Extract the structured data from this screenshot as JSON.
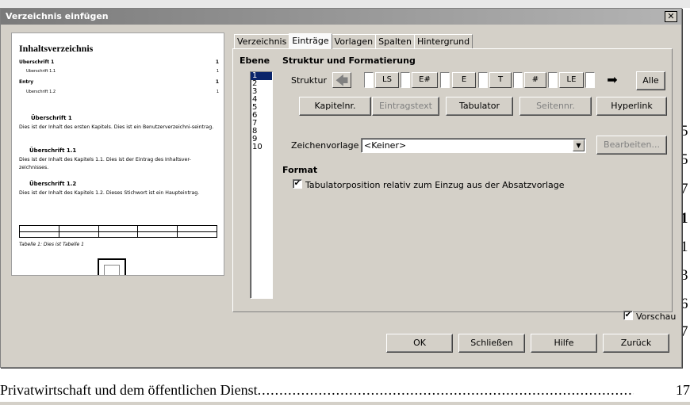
{
  "background": {
    "right_digits": [
      "5",
      "5",
      "7",
      "1",
      "1",
      "3",
      "6",
      "7"
    ],
    "bottom_line": {
      "text": "Privatwirtschaft und dem öffentlichen Dienst",
      "dots": "......................................................................................................",
      "page": "17"
    }
  },
  "dialog": {
    "title": "Verzeichnis einfügen",
    "close_glyph": "✕",
    "preview": {
      "title": "Inhaltsverzeichnis",
      "toc": [
        {
          "text": "Überschrift 1",
          "page": "1"
        },
        {
          "text": "Überschrift 1.1",
          "page": "1"
        },
        {
          "text": "Entry",
          "page": "1"
        },
        {
          "text": "Überschrift 1.2",
          "page": "1"
        }
      ],
      "h1": "Überschrift 1",
      "p1": "Dies ist der Inhalt des ersten Kapitels. Dies ist ein Benutzerverzeichni-seintrag.",
      "h11": "Überschrift 1.1",
      "p11": "Dies ist der Inhalt des Kapitels 1.1. Dies ist der Eintrag des Inhaltsver-zeichnisses.",
      "h12": "Überschrift 1.2",
      "p12": "Dies ist der Inhalt des Kapitels 1.2. Dieses Stichwort ist ein Haupteintrag.",
      "caption": "Tabelle 1: Dies ist Tabelle 1"
    },
    "tabs": [
      "Verzeichnis",
      "Einträge",
      "Vorlagen",
      "Spalten",
      "Hintergrund"
    ],
    "active_tab": "Einträge",
    "entries": {
      "level_label": "Ebene",
      "levels": [
        "1",
        "2",
        "3",
        "4",
        "5",
        "6",
        "7",
        "8",
        "9",
        "10"
      ],
      "selected_level": "1",
      "section_title": "Struktur und Formatierung",
      "structure_label": "Struktur",
      "tokens": [
        "LS",
        "E#",
        "E",
        "T",
        "#",
        "LE"
      ],
      "all_button": "Alle",
      "insert_buttons": [
        {
          "label": "Kapitelnr.",
          "enabled": true
        },
        {
          "label": "Eintragstext",
          "enabled": false
        },
        {
          "label": "Tabulator",
          "enabled": true
        },
        {
          "label": "Seitennr.",
          "enabled": false
        },
        {
          "label": "Hyperlink",
          "enabled": true
        }
      ],
      "charstyle_label": "Zeichenvorlage",
      "charstyle_value": "<Keiner>",
      "edit_button": "Bearbeiten...",
      "format_title": "Format",
      "tab_position_label": "Tabulatorposition relativ zum Einzug aus der Absatzvorlage",
      "tab_position_checked": true
    },
    "preview_checkbox": {
      "label": "Vorschau",
      "checked": true
    },
    "footer_buttons": [
      "OK",
      "Schließen",
      "Hilfe",
      "Zurück"
    ],
    "check_glyph": "✔",
    "arrow_left_glyph": "🡄",
    "arrow_right_glyph": "➡",
    "dropdown_glyph": "▼"
  }
}
